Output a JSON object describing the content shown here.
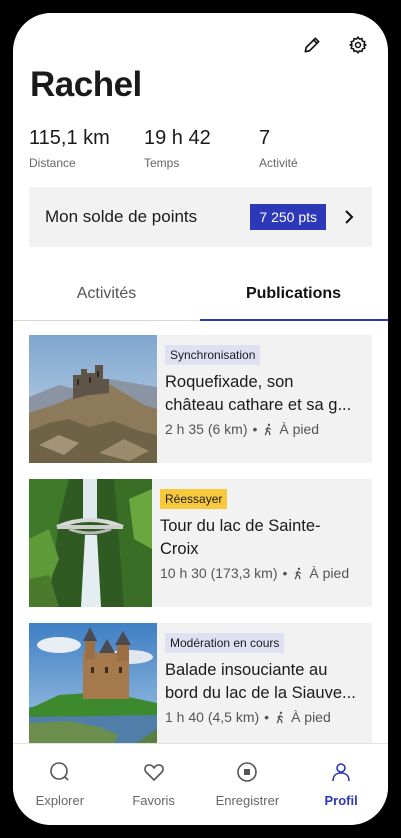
{
  "profile": {
    "name": "Rachel"
  },
  "stats": [
    {
      "value": "115,1 km",
      "label": "Distance"
    },
    {
      "value": "19 h 42",
      "label": "Temps"
    },
    {
      "value": "7",
      "label": "Activité"
    }
  ],
  "points": {
    "title": "Mon solde de points",
    "value": "7 250 pts"
  },
  "tabs": [
    {
      "label": "Activités",
      "active": false
    },
    {
      "label": "Publications",
      "active": true
    }
  ],
  "publications": [
    {
      "status": "Synchronisation",
      "title_line1": "Roquefixade, son",
      "title_line2": "château cathare et sa g...",
      "duration": "2 h 35 (6 km)",
      "activity": "À pied"
    },
    {
      "status": "Réessayer",
      "title_line1": "Tour du lac de Sainte-",
      "title_line2": "Croix",
      "duration": "10 h 30 (173,3 km)",
      "activity": "À pied"
    },
    {
      "status": "Modération en cours",
      "title_line1": "Balade insouciante au",
      "title_line2": "bord du lac de la Siauve...",
      "duration": "1 h 40 (4,5 km)",
      "activity": "À pied"
    }
  ],
  "nav": [
    {
      "label": "Explorer",
      "icon": "search-icon",
      "active": false
    },
    {
      "label": "Favoris",
      "icon": "heart-icon",
      "active": false
    },
    {
      "label": "Enregistrer",
      "icon": "record-icon",
      "active": false
    },
    {
      "label": "Profil",
      "icon": "profile-icon",
      "active": true
    }
  ],
  "colors": {
    "accent": "#2c38b8",
    "retry": "#f7c93b",
    "tag": "#dfe1f3"
  }
}
